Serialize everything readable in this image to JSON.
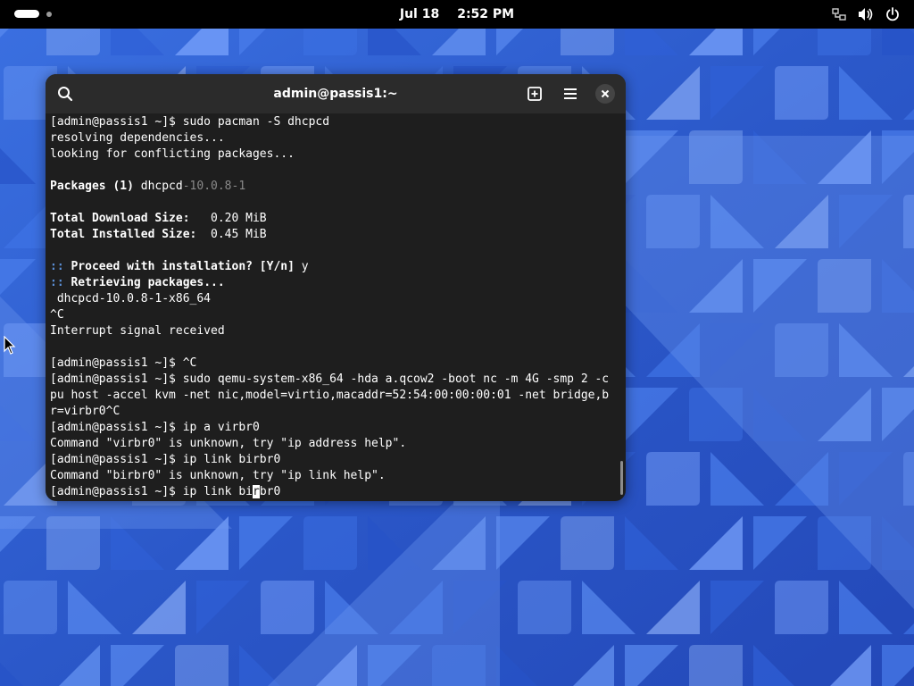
{
  "topbar": {
    "date": "Jul 18",
    "time": "2:52 PM",
    "icons": [
      "network-icon",
      "volume-icon",
      "power-icon"
    ]
  },
  "window": {
    "title": "admin@passis1:~",
    "buttons": [
      "search-icon",
      "new-tab-icon",
      "menu-icon",
      "close-icon"
    ]
  },
  "terminal": {
    "lines": [
      [
        {
          "t": "[admin@passis1 ~]$ sudo pacman -S dhcpcd"
        }
      ],
      [
        {
          "t": "resolving dependencies..."
        }
      ],
      [
        {
          "t": "looking for conflicting packages..."
        }
      ],
      [],
      [
        {
          "t": "Packages (1) ",
          "s": "b"
        },
        {
          "t": "dhcpcd"
        },
        {
          "t": "-10.0.8-1",
          "s": "dim"
        }
      ],
      [],
      [
        {
          "t": "Total Download Size:  ",
          "s": "b"
        },
        {
          "t": " 0.20 MiB"
        }
      ],
      [
        {
          "t": "Total Installed Size:  ",
          "s": "b"
        },
        {
          "t": "0.45 MiB"
        }
      ],
      [],
      [
        {
          "t": ":: ",
          "s": "blue"
        },
        {
          "t": "Proceed with installation? [Y/n] ",
          "s": "b"
        },
        {
          "t": "y"
        }
      ],
      [
        {
          "t": ":: ",
          "s": "blue"
        },
        {
          "t": "Retrieving packages...",
          "s": "b"
        }
      ],
      [
        {
          "t": " dhcpcd-10.0.8-1-x86_64"
        }
      ],
      [
        {
          "t": "^C"
        }
      ],
      [
        {
          "t": "Interrupt signal received"
        }
      ],
      [],
      [
        {
          "t": "[admin@passis1 ~]$ ^C"
        }
      ],
      [
        {
          "t": "[admin@passis1 ~]$ sudo qemu-system-x86_64 -hda a.qcow2 -boot nc -m 4G -smp 2 -c"
        }
      ],
      [
        {
          "t": "pu host -accel kvm -net nic,model=virtio,macaddr=52:54:00:00:00:01 -net bridge,b"
        }
      ],
      [
        {
          "t": "r=virbr0^C"
        }
      ],
      [
        {
          "t": "[admin@passis1 ~]$ ip a virbr0"
        }
      ],
      [
        {
          "t": "Command \"virbr0\" is unknown, try \"ip address help\"."
        }
      ],
      [
        {
          "t": "[admin@passis1 ~]$ ip link birbr0"
        }
      ],
      [
        {
          "t": "Command \"birbr0\" is unknown, try \"ip link help\"."
        }
      ],
      [
        {
          "t": "[admin@passis1 ~]$ ip link bi"
        },
        {
          "t": "r",
          "s": "cursor"
        },
        {
          "t": "br0"
        }
      ]
    ]
  },
  "colors": {
    "wallpaper_base": "#2f5fd0",
    "terminal_bg": "#1e1e1e",
    "headerbar_bg": "#2b2b2b",
    "prompt_accent": "#5b8fd6"
  }
}
